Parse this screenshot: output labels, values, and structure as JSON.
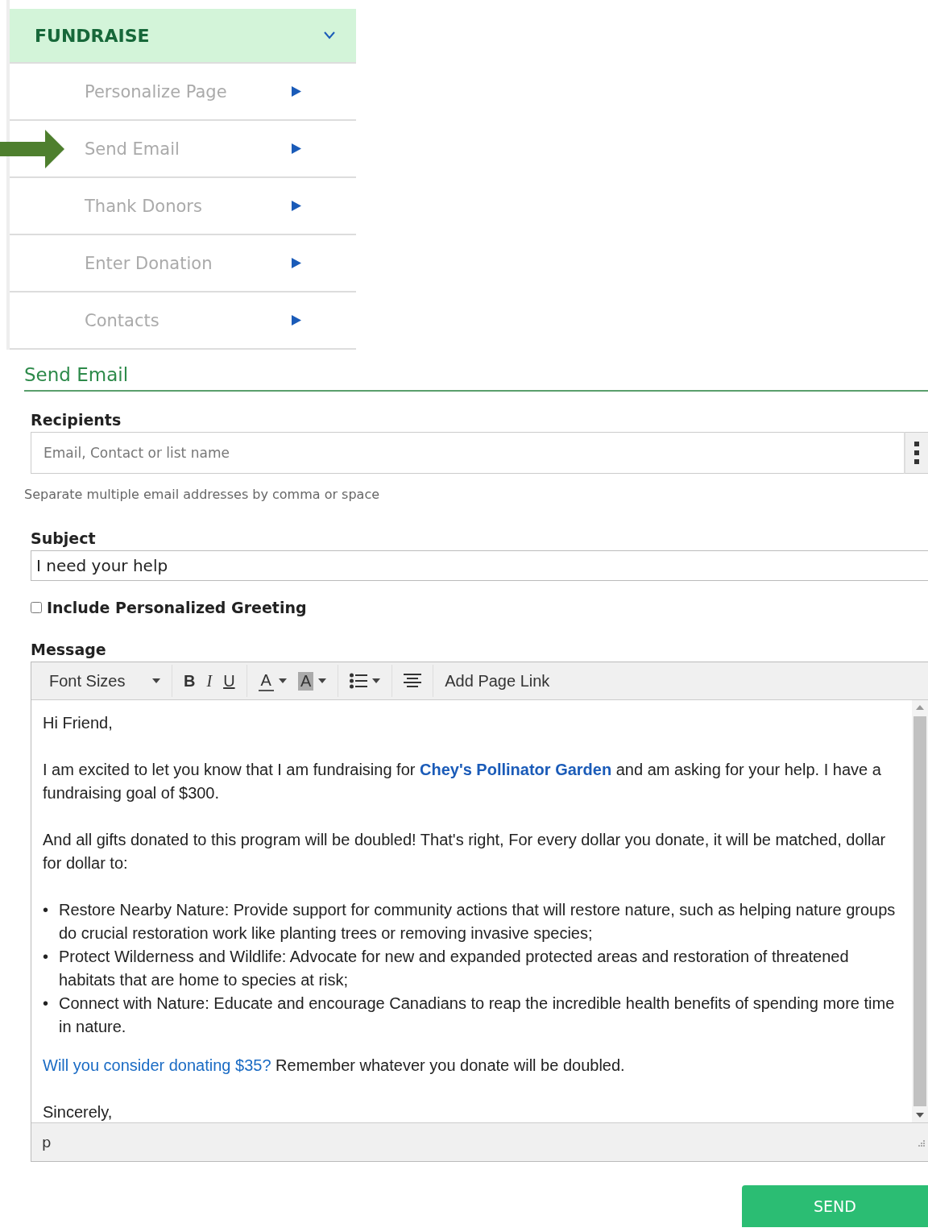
{
  "menu": {
    "title": "FUNDRAISE",
    "expanded": true,
    "items": [
      {
        "label": "Personalize Page",
        "pointed": false
      },
      {
        "label": "Send Email",
        "pointed": true
      },
      {
        "label": "Thank Donors",
        "pointed": false
      },
      {
        "label": "Enter Donation",
        "pointed": false
      },
      {
        "label": "Contacts",
        "pointed": false
      }
    ]
  },
  "section_title": "Send Email",
  "recipients": {
    "label": "Recipients",
    "placeholder": "Email, Contact or list name",
    "hint": "Separate multiple email addresses by comma or space"
  },
  "subject": {
    "label": "Subject",
    "value": "I need your help"
  },
  "greeting": {
    "label": "Include Personalized Greeting",
    "checked": false
  },
  "message": {
    "label": "Message",
    "toolbar": [
      [
        {
          "kind": "select",
          "label": "Font Sizes"
        }
      ],
      [
        {
          "kind": "bold",
          "label": "B"
        },
        {
          "kind": "italic",
          "label": "I"
        },
        {
          "kind": "underline",
          "label": "U"
        }
      ],
      [
        {
          "kind": "text-color",
          "label": "A"
        },
        {
          "kind": "back-color",
          "label": "A"
        }
      ],
      [
        {
          "kind": "bullet-list"
        }
      ],
      [
        {
          "kind": "align-center"
        }
      ],
      [
        {
          "kind": "link",
          "label": "Add Page Link"
        }
      ]
    ],
    "body": [
      {
        "kind": "text",
        "text": "Hi Friend,"
      },
      {
        "kind": "text",
        "text": "I am excited to let you know that I am fundraising for **Chey's Pollinator Garden** and am asking for your help.  I have a fundraising goal of $300."
      },
      {
        "kind": "text",
        "text": "And all gifts donated to this program will be doubled! That's right, For every dollar you donate, it will be matched, dollar for dollar to:"
      },
      {
        "kind": "list",
        "items": [
          {
            "bullet": "•",
            "text": "Restore Nearby Nature: Provide support for community actions that will restore nature, such as helping nature groups do crucial restoration work like planting trees or removing invasive species;"
          },
          {
            "bullet": "•",
            "text": "Protect Wilderness and Wildlife: Advocate for new and expanded protected areas and restoration of threatened habitats that are home to species at risk;"
          },
          {
            "bullet": "•",
            "text": "Connect with Nature: Educate and encourage Canadians to reap the incredible health benefits of spending more time in nature."
          }
        ]
      },
      {
        "kind": "link-text",
        "link": "Will you consider donating $35?",
        "text": "Remember whatever you donate will be doubled."
      },
      {
        "kind": "text",
        "text": "Sincerely,"
      }
    ],
    "path": "p"
  },
  "send_button": "SEND"
}
